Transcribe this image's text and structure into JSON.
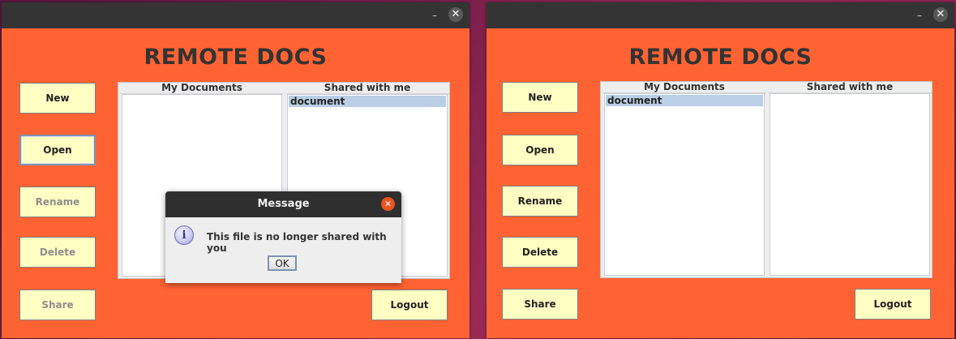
{
  "left_window": {
    "title": "REMOTE DOCS",
    "minimize_glyph": "–",
    "close_glyph": "✕",
    "buttons": {
      "new": "New",
      "open": "Open",
      "rename": "Rename",
      "delete": "Delete",
      "share": "Share",
      "logout": "Logout"
    },
    "my_documents": {
      "title": "My Documents",
      "items": []
    },
    "shared_with_me": {
      "title": "Shared with me",
      "items": [
        "document"
      ]
    }
  },
  "dialog": {
    "title": "Message",
    "close_glyph": "✕",
    "icon_glyph": "i",
    "message": "This file is no longer shared with you",
    "ok": "OK"
  },
  "right_window": {
    "title": "REMOTE DOCS",
    "minimize_glyph": "–",
    "close_glyph": "✕",
    "buttons": {
      "new": "New",
      "open": "Open",
      "rename": "Rename",
      "delete": "Delete",
      "share": "Share",
      "logout": "Logout"
    },
    "my_documents": {
      "title": "My Documents",
      "items": [
        "document"
      ]
    },
    "shared_with_me": {
      "title": "Shared with me",
      "items": []
    }
  },
  "colors": {
    "window_bg": "#ff6333",
    "button_bg": "#ffffc4",
    "selection": "#b8cfe5",
    "titlebar": "#343434",
    "dialog_close": "#e95420"
  }
}
